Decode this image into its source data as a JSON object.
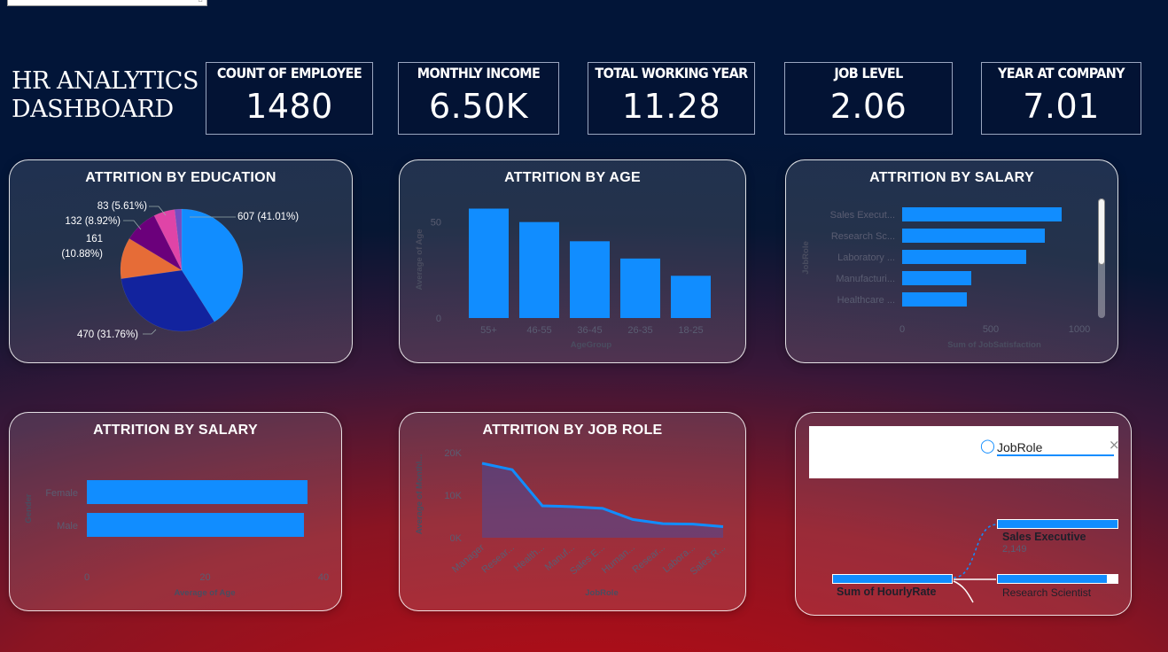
{
  "title": {
    "line1": "HR ANALYTICS",
    "line2": "DASHBOARD"
  },
  "kpis": [
    {
      "label": "COUNT OF EMPLOYEE",
      "value": "1480"
    },
    {
      "label": "MONTHLY INCOME",
      "value": "6.50K"
    },
    {
      "label": "TOTAL WORKING YEAR",
      "value": "11.28"
    },
    {
      "label": "JOB LEVEL",
      "value": "2.06"
    },
    {
      "label": "YEAR AT COMPANY",
      "value": "7.01"
    }
  ],
  "charts": {
    "education": {
      "title": "ATTRITION BY EDUCATION"
    },
    "age": {
      "title": "ATTRITION BY AGE"
    },
    "salary_role": {
      "title": "ATTRITION BY SALARY"
    },
    "salary_gender": {
      "title": "ATTRITION BY SALARY"
    },
    "job_role": {
      "title": "ATTRITION BY JOB ROLE"
    }
  },
  "decomp": {
    "search_value": "JobRole",
    "root_label": "Sum of HourlyRate",
    "node1_label": "Sales Executive",
    "node1_value": "2,149",
    "node2_label": "Research Scientist"
  },
  "colors": {
    "accent": "#118dff",
    "navy": "#12239e",
    "orange": "#e66c37",
    "purple": "#6b007b",
    "pink": "#e044a7",
    "violet": "#744ec2"
  },
  "chart_data": [
    {
      "id": "education",
      "type": "pie",
      "slices": [
        {
          "value": 607,
          "label": "607 (41.01%)",
          "color": "#118dff"
        },
        {
          "value": 470,
          "label": "470 (31.76%)",
          "color": "#12239e"
        },
        {
          "value": 161,
          "label": "161 (10.88%)",
          "label_lines": [
            "161",
            "(10.88%)"
          ],
          "color": "#e66c37"
        },
        {
          "value": 132,
          "label": "132 (8.92%)",
          "color": "#6b007b"
        },
        {
          "value": 83,
          "label": "83 (5.61%)",
          "color": "#e044a7"
        },
        {
          "value": 27,
          "label": "",
          "color": "#744ec2"
        }
      ]
    },
    {
      "id": "age",
      "type": "bar",
      "categories": [
        "55+",
        "46-55",
        "36-45",
        "26-35",
        "18-25"
      ],
      "values": [
        57,
        50,
        40,
        31,
        22
      ],
      "ylabel": "Average of Age",
      "xlabel": "AgeGroup",
      "yticks": [
        0,
        50
      ],
      "ylim": [
        0,
        60
      ]
    },
    {
      "id": "salary_role",
      "type": "bar",
      "orientation": "horizontal",
      "categories": [
        "Sales Execut...",
        "Research Sc...",
        "Laboratory ...",
        "Manufacturi...",
        "Healthcare ..."
      ],
      "values": [
        900,
        805,
        700,
        390,
        365
      ],
      "ylabel": "JobRole",
      "xlabel": "Sum of JobSatisfaction",
      "xticks": [
        0,
        500,
        1000
      ],
      "xlim": [
        0,
        1100
      ]
    },
    {
      "id": "salary_gender",
      "type": "bar",
      "orientation": "horizontal",
      "categories": [
        "Female",
        "Male"
      ],
      "values": [
        37.3,
        36.7
      ],
      "ylabel": "Gender",
      "xlabel": "Average of Age",
      "xticks": [
        0,
        20,
        40
      ],
      "xlim": [
        0,
        40
      ]
    },
    {
      "id": "job_role",
      "type": "area",
      "categories": [
        "Manager",
        "Resear...",
        "Health...",
        "Manuf...",
        "Sales E...",
        "Human...",
        "Resear...",
        "Labora...",
        "Sales R..."
      ],
      "values": [
        17500,
        16000,
        7500,
        7300,
        6900,
        4300,
        3300,
        3200,
        2600
      ],
      "ylabel": "Average of Monthl...",
      "xlabel": "JobRole",
      "yticks": [
        0,
        10000,
        20000
      ],
      "ytick_labels": [
        "0K",
        "10K",
        "20K"
      ],
      "ylim": [
        0,
        20000
      ]
    }
  ]
}
